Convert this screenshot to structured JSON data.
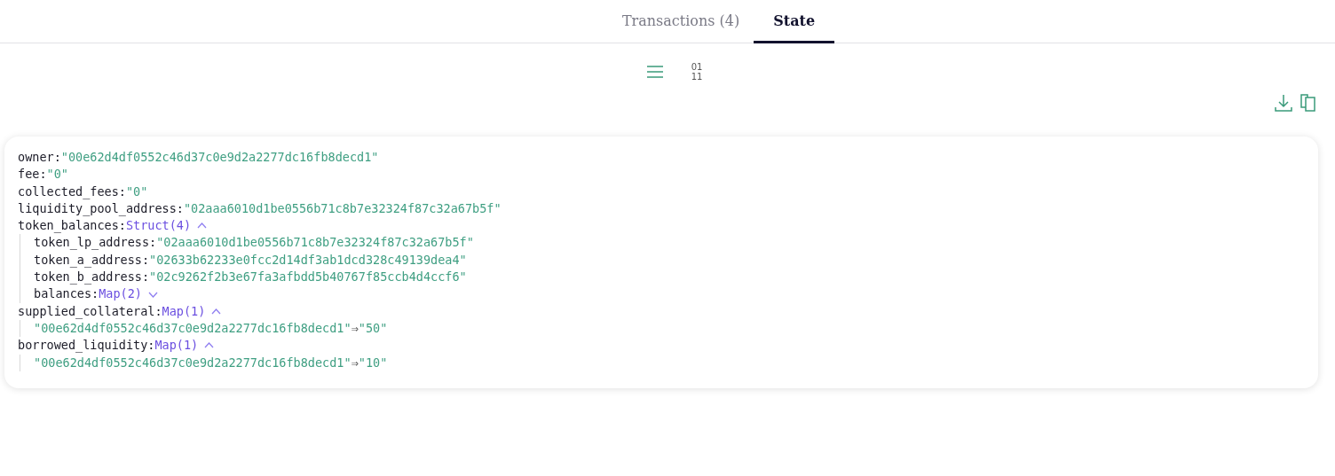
{
  "tabs": [
    {
      "label": "Transactions (4)",
      "selected": false
    },
    {
      "label": "State",
      "selected": true
    }
  ],
  "view_toggles": [
    {
      "kind": "list",
      "selected": true
    },
    {
      "kind": "binary",
      "lines": [
        "01",
        "11"
      ],
      "selected": false
    }
  ],
  "actions": [
    {
      "kind": "download"
    },
    {
      "kind": "copy"
    }
  ],
  "state": [
    {
      "kind": "field",
      "key": "owner:",
      "value": "\"00e62d4df0552c46d37c0e9d2a2277dc16fb8decd1\""
    },
    {
      "kind": "field",
      "key": "fee:",
      "value": "\"0\""
    },
    {
      "kind": "field",
      "key": "collected_fees:",
      "value": "\"0\""
    },
    {
      "kind": "field",
      "key": "liquidity_pool_address:",
      "value": "\"02aaa6010d1be0556b71c8b7e32324f87c32a67b5f\""
    },
    {
      "kind": "group",
      "key": "token_balances:",
      "type": "Struct(4)",
      "expanded": true,
      "children": [
        {
          "kind": "field",
          "key": "token_lp_address:",
          "value": "\"02aaa6010d1be0556b71c8b7e32324f87c32a67b5f\""
        },
        {
          "kind": "field",
          "key": "token_a_address:",
          "value": "\"02633b62233e0fcc2d14df3ab1dcd328c49139dea4\""
        },
        {
          "kind": "field",
          "key": "token_b_address:",
          "value": "\"02c9262f2b3e67fa3afbdd5b40767f85ccb4d4ccf6\""
        },
        {
          "kind": "group",
          "key": "balances:",
          "type": "Map(2)",
          "expanded": false
        }
      ]
    },
    {
      "kind": "group",
      "key": "supplied_collateral:",
      "type": "Map(1)",
      "expanded": true,
      "children": [
        {
          "kind": "entry",
          "key": "\"00e62d4df0552c46d37c0e9d2a2277dc16fb8decd1\"",
          "arrow": "⇒",
          "value": "\"50\""
        }
      ]
    },
    {
      "kind": "group",
      "key": "borrowed_liquidity:",
      "type": "Map(1)",
      "expanded": true,
      "children": [
        {
          "kind": "entry",
          "key": "\"00e62d4df0552c46d37c0e9d2a2277dc16fb8decd1\"",
          "arrow": "⇒",
          "value": "\"10\""
        }
      ]
    }
  ]
}
